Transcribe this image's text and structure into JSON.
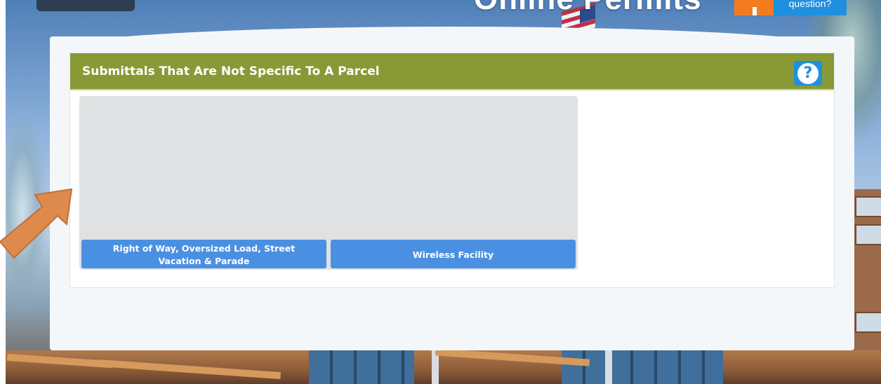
{
  "background": {
    "header_title": "Online Permits",
    "question_button_label": "question?"
  },
  "section": {
    "title": "Submittals That Are Not Specific To A Parcel",
    "help_icon_glyph": "?",
    "tiles": [
      {
        "label": "Right of Way, Oversized Load, Street Vacation & Parade"
      },
      {
        "label": "Wireless Facility"
      }
    ]
  },
  "colors": {
    "header_green": "#889936",
    "tile_button_blue": "#4a90e2",
    "help_button_blue": "#1f8fe0",
    "tile_gray": "#e0e1e3",
    "annotation_arrow_orange": "#dd8a4c"
  },
  "icons": {
    "help": "help-icon",
    "annotation": "arrow-annotation-icon"
  }
}
